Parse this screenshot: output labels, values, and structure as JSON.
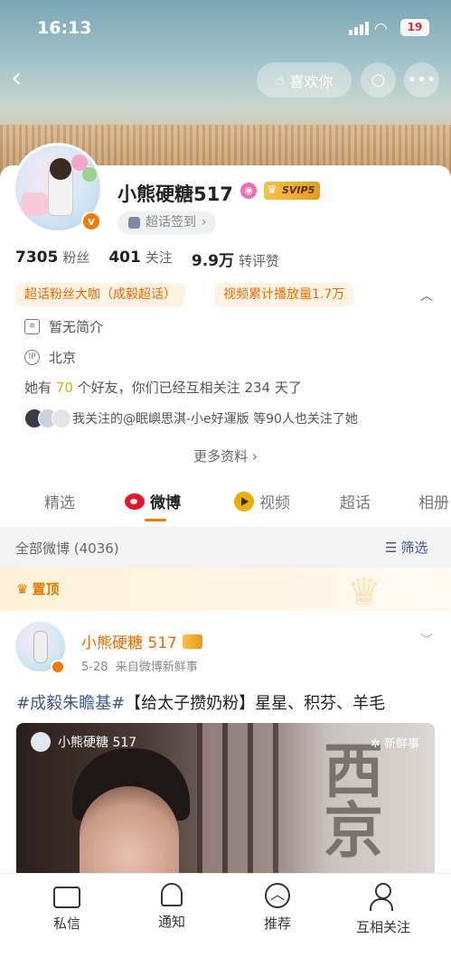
{
  "status": {
    "time": "16:13",
    "battery": "19"
  },
  "header": {
    "like_label": "喜欢你"
  },
  "profile": {
    "name": "小熊硬糖517",
    "vip": "SVIP5",
    "supertopic_signin": "超话签到",
    "stats": [
      {
        "value": "7305",
        "label": "粉丝"
      },
      {
        "value": "401",
        "label": "关注"
      },
      {
        "value": "9.9万",
        "label": "转评赞"
      }
    ],
    "tags": [
      "超话粉丝大咖（成毅超话）",
      "视频累计播放量1.7万"
    ],
    "bio": "暂无简介",
    "location": "北京",
    "friends_prefix": "她有",
    "friends_count": "70",
    "friends_suffix": "个好友，你们已经互相关注 234 天了",
    "mutual_text": "我关注的@眠嶼思淇-小e好運版 等90人也关注了她",
    "more_info": "更多资料"
  },
  "tabs": [
    "精选",
    "微博",
    "视频",
    "超话",
    "相册"
  ],
  "filter": {
    "all": "全部微博 (4036)",
    "filter_label": "筛选"
  },
  "pinned_label": "置顶",
  "post": {
    "author": "小熊硬糖 517",
    "date": "5-28",
    "source": "来自微博新鲜事",
    "hashtag": "#成毅朱瞻基#",
    "text": "【给太子攒奶粉】星星、积芬、羊毛",
    "image_watermark": "小熊硬糖 517",
    "image_badge": "新鲜事",
    "image_calligraphy": "西京"
  },
  "bottom_bar": [
    {
      "label": "私信",
      "icon": "message-icon"
    },
    {
      "label": "通知",
      "icon": "bell-icon"
    },
    {
      "label": "推荐",
      "icon": "recommend-icon"
    },
    {
      "label": "互相关注",
      "icon": "mutual-follow-icon"
    }
  ]
}
